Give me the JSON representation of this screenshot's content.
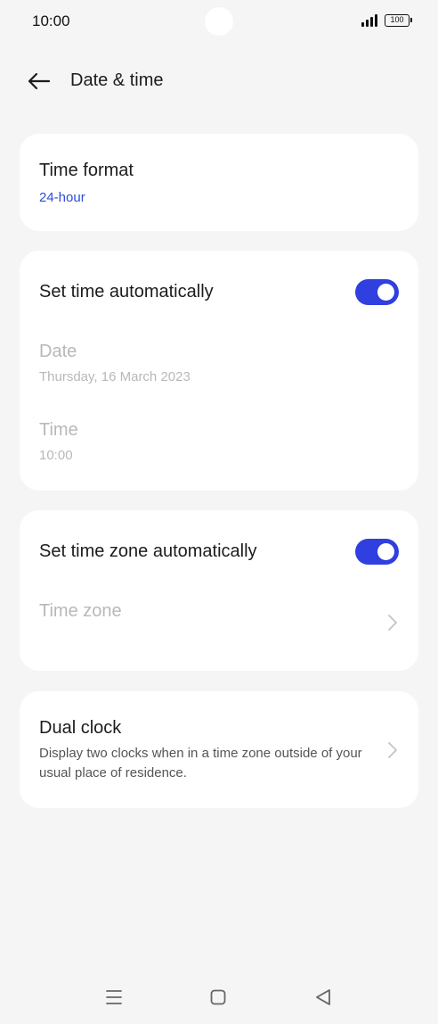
{
  "status_bar": {
    "time": "10:00",
    "battery": "100"
  },
  "header": {
    "title": "Date & time"
  },
  "time_format": {
    "title": "Time format",
    "value": "24-hour"
  },
  "auto_time": {
    "title": "Set time automatically",
    "enabled": true,
    "date": {
      "title": "Date",
      "value": "Thursday, 16 March 2023"
    },
    "time": {
      "title": "Time",
      "value": "10:00"
    }
  },
  "auto_timezone": {
    "title": "Set time zone automatically",
    "enabled": true,
    "timezone": {
      "title": "Time zone"
    }
  },
  "dual_clock": {
    "title": "Dual clock",
    "description": "Display two clocks when in a time zone outside of your usual place of residence."
  },
  "colors": {
    "accent": "#2f4bd6",
    "toggle": "#2f3fe0",
    "background": "#f5f5f5",
    "card": "#ffffff",
    "disabled": "#b8b8b8"
  },
  "icons": {
    "back": "arrow-left",
    "chevron": "chevron-right",
    "nav": [
      "menu",
      "home-square",
      "back-triangle"
    ]
  }
}
